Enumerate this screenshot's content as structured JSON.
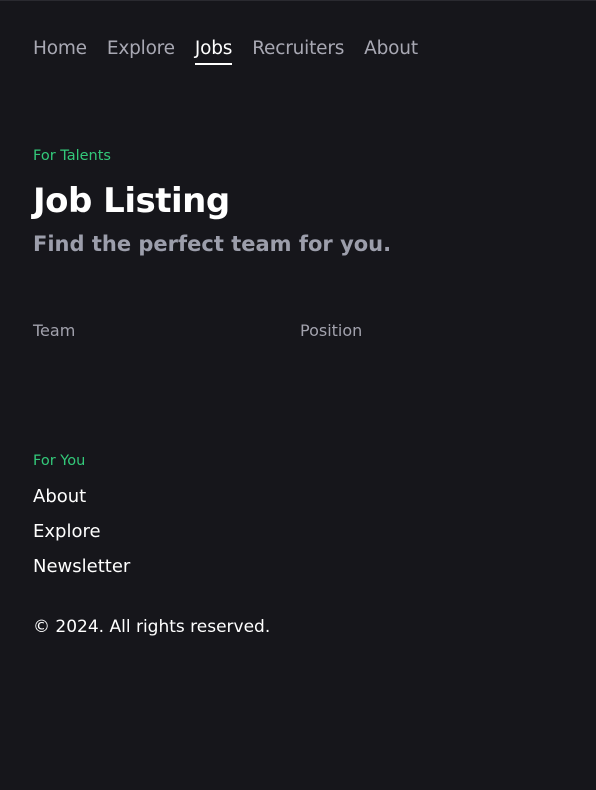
{
  "nav": {
    "items": [
      {
        "label": "Home",
        "active": false
      },
      {
        "label": "Explore",
        "active": false
      },
      {
        "label": "Jobs",
        "active": true
      },
      {
        "label": "Recruiters",
        "active": false
      },
      {
        "label": "About",
        "active": false
      }
    ]
  },
  "hero": {
    "eyebrow": "For Talents",
    "title": "Job Listing",
    "subtitle": "Find the perfect team for you."
  },
  "filters": {
    "team_label": "Team",
    "position_label": "Position"
  },
  "footer": {
    "eyebrow": "For You",
    "links": [
      "About",
      "Explore",
      "Newsletter"
    ],
    "copyright": "© 2024. All rights reserved."
  },
  "colors": {
    "background": "#16161b",
    "accent": "#33c97a",
    "muted_text": "#a8a8b3",
    "subtitle_text": "#9c9eab"
  }
}
